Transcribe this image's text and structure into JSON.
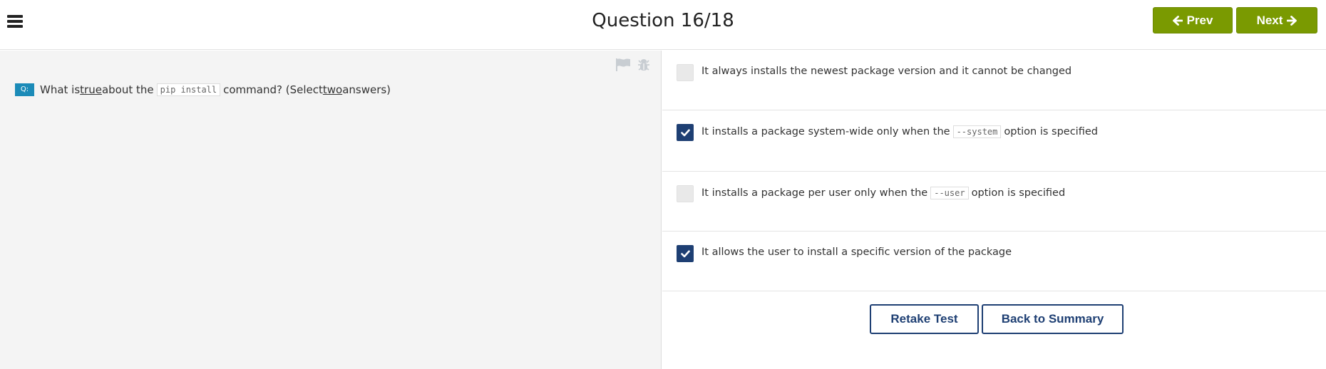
{
  "header": {
    "title": "Question 16/18",
    "prev_label": "Prev",
    "next_label": "Next"
  },
  "question": {
    "badge": "Q:",
    "parts": {
      "t1": "What is ",
      "t2": "true",
      "t3": " about the ",
      "code": "pip install",
      "t4": " command? (Select ",
      "t5": "two",
      "t6": " answers)"
    }
  },
  "answers": [
    {
      "checked": false,
      "before": "It always installs the newest package version and it cannot be changed",
      "code": "",
      "after": ""
    },
    {
      "checked": true,
      "before": "It installs a package system-wide only when the",
      "code": "--system",
      "after": "option is specified"
    },
    {
      "checked": false,
      "before": "It installs a package per user only when the",
      "code": "--user",
      "after": "option is specified"
    },
    {
      "checked": true,
      "before": "It allows the user to install a specific version of the package",
      "code": "",
      "after": ""
    }
  ],
  "actions": {
    "retake_label": "Retake Test",
    "back_label": "Back to Summary"
  },
  "colors": {
    "nav_green": "#7a9a01",
    "checkbox_checked": "#1e3f73",
    "badge_blue": "#1b8bb8"
  },
  "icons": [
    "menu-icon",
    "arrow-left-icon",
    "arrow-right-icon",
    "flag-icon",
    "bug-icon",
    "checkmark-icon"
  ]
}
